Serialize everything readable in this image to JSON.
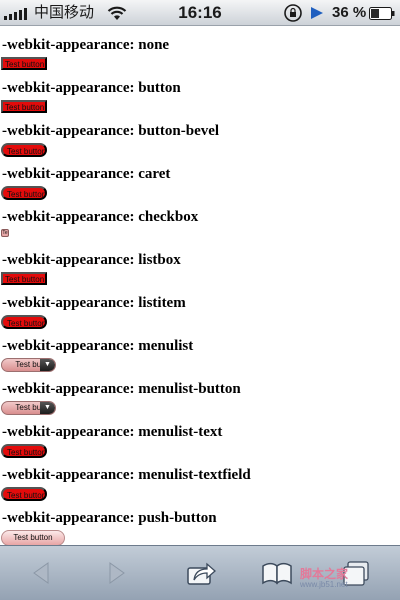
{
  "status_bar": {
    "carrier": "中国移动",
    "time": "16:16",
    "battery": "36 %",
    "icons": [
      "signal-icon",
      "wifi-icon",
      "rotation-lock-icon",
      "play-icon",
      "battery-icon"
    ]
  },
  "rows": [
    {
      "heading": "-webkit-appearance: none",
      "button_label": "Test button",
      "style": "rect"
    },
    {
      "heading": "-webkit-appearance: button",
      "button_label": "Test button",
      "style": "rect"
    },
    {
      "heading": "-webkit-appearance: button-bevel",
      "button_label": "Test button",
      "style": "pill"
    },
    {
      "heading": "-webkit-appearance: caret",
      "button_label": "Test button",
      "style": "pill"
    },
    {
      "heading": "-webkit-appearance: checkbox",
      "button_label": "Te",
      "style": "checkbox"
    },
    {
      "heading": "-webkit-appearance: listbox",
      "button_label": "Test button",
      "style": "rect"
    },
    {
      "heading": "-webkit-appearance: listitem",
      "button_label": "Test button",
      "style": "pill"
    },
    {
      "heading": "-webkit-appearance: menulist",
      "button_label": "Test butt",
      "style": "menulist"
    },
    {
      "heading": "-webkit-appearance: menulist-button",
      "button_label": "Test butt",
      "style": "menulist"
    },
    {
      "heading": "-webkit-appearance: menulist-text",
      "button_label": "Test button",
      "style": "pill"
    },
    {
      "heading": "-webkit-appearance: menulist-textfield",
      "button_label": "Test button",
      "style": "pill"
    },
    {
      "heading": "-webkit-appearance: push-button",
      "button_label": "Test button",
      "style": "push"
    }
  ],
  "toolbar": {
    "items": [
      "back-icon",
      "forward-icon",
      "share-icon",
      "bookmarks-icon",
      "tabs-icon"
    ]
  },
  "watermark": {
    "text": "脚本之家",
    "sub": "www.jb51.net"
  },
  "colors": {
    "button_red": "#e30b0b",
    "toolbar_top": "#c2ccd7",
    "toolbar_bottom": "#94a2b3"
  }
}
